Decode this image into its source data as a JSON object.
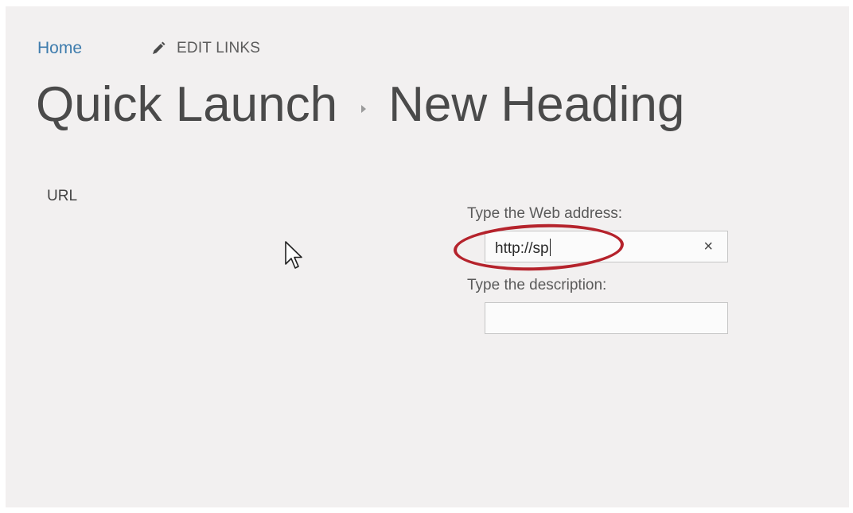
{
  "nav": {
    "home": "Home",
    "edit_links": "EDIT LINKS"
  },
  "title": {
    "parent": "Quick Launch",
    "current": "New Heading"
  },
  "form": {
    "url_label": "URL",
    "web_address_label": "Type the Web address:",
    "web_address_value": "http://sp",
    "description_label": "Type the description:",
    "description_value": "",
    "clear_symbol": "×"
  },
  "icons": {
    "edit": "pencil-icon",
    "clear": "close-icon",
    "pointer": "mouse-cursor-icon",
    "breadcrumb_separator": "chevron-right-icon"
  },
  "colors": {
    "link": "#3e7cad",
    "highlight": "#b5232c",
    "background": "#f2f0f0"
  }
}
